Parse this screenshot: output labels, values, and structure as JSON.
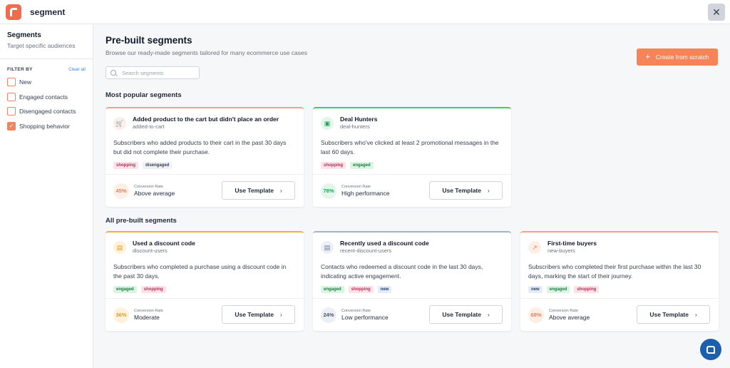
{
  "app": {
    "title": "segment",
    "close_glyph": "✕"
  },
  "sidebar": {
    "title": "Segments",
    "subtitle": "Target specific audiences",
    "filter_label": "FILTER BY",
    "clear_all": "Clear all",
    "filters": [
      {
        "label": "New",
        "checked": false
      },
      {
        "label": "Engaged contacts",
        "checked": false
      },
      {
        "label": "Disengaged contacts",
        "checked": false
      },
      {
        "label": "Shopping behavior",
        "checked": true
      }
    ]
  },
  "main": {
    "title": "Pre-built segments",
    "subtitle": "Browse our ready-made segments tailored for many ecommerce use cases",
    "create_button": "Create from scratch",
    "search_placeholder": "Search segments",
    "popular_title": "Most popular segments",
    "all_title": "All pre-built segments",
    "rate_label": "Conversion Rate",
    "use_label": "Use Template"
  },
  "popular": [
    {
      "title": "Added product to the cart but didn't place an order",
      "slug": "added-to-cart",
      "desc": "Subscribers who added products to their cart in the past 30 days but did not complete their purchase.",
      "tags": [
        "shopping",
        "disengaged"
      ],
      "rate": "45%",
      "rate_text": "Above average",
      "accent": "#f3a27f",
      "icon": "cart-icon",
      "icon_glyph": "🛒",
      "icon_bg": "#fdeee6",
      "icon_color": "#f07c4c",
      "badge_bg": "#fdeee6",
      "badge_color": "#f07c4c"
    },
    {
      "title": "Deal Hunters",
      "slug": "deal-hunters",
      "desc": "Subscribers who've clicked at least 2 promotional messages in the last 60 days.",
      "tags": [
        "shopping",
        "engaged"
      ],
      "rate": "78%",
      "rate_text": "High performance",
      "accent": "#3ccb6b",
      "icon": "coupon-icon",
      "icon_glyph": "▣",
      "icon_bg": "#e2f6ea",
      "icon_color": "#22a35a",
      "badge_bg": "#e2f6ea",
      "badge_color": "#22a35a"
    }
  ],
  "all": [
    {
      "title": "Used a discount code",
      "slug": "discount-users",
      "desc": "Subscribers who completed a purchase using a discount code in the past 30 days.",
      "tags": [
        "engaged",
        "shopping"
      ],
      "rate": "36%",
      "rate_text": "Moderate",
      "accent": "#f0b030",
      "icon": "ticket-icon",
      "icon_glyph": "▤",
      "icon_bg": "#fdf3dc",
      "icon_color": "#e49b12",
      "badge_bg": "#fdf3dc",
      "badge_color": "#e49b12"
    },
    {
      "title": "Recently used a discount code",
      "slug": "recent-discount-users",
      "desc": "Contacts who redeemed a discount code in the last 30 days, indicating active engagement.",
      "tags": [
        "engaged",
        "shopping",
        "new"
      ],
      "rate": "24%",
      "rate_text": "Low performance",
      "accent": "#a8b0c4",
      "icon": "ticket-icon",
      "icon_glyph": "▤",
      "icon_bg": "#eceff5",
      "icon_color": "#6b7794",
      "badge_bg": "#eceff5",
      "badge_color": "#4b5563"
    },
    {
      "title": "First-time buyers",
      "slug": "new-buyers",
      "desc": "Subscribers who completed their first purchase within the last 30 days, marking the start of their journey.",
      "tags": [
        "new",
        "engaged",
        "shopping"
      ],
      "rate": "68%",
      "rate_text": "Above average",
      "accent": "#f3a27f",
      "icon": "trend-up-icon",
      "icon_glyph": "↗",
      "icon_bg": "#fdeee6",
      "icon_color": "#f07c4c",
      "badge_bg": "#fdeee6",
      "badge_color": "#f07c4c"
    }
  ]
}
